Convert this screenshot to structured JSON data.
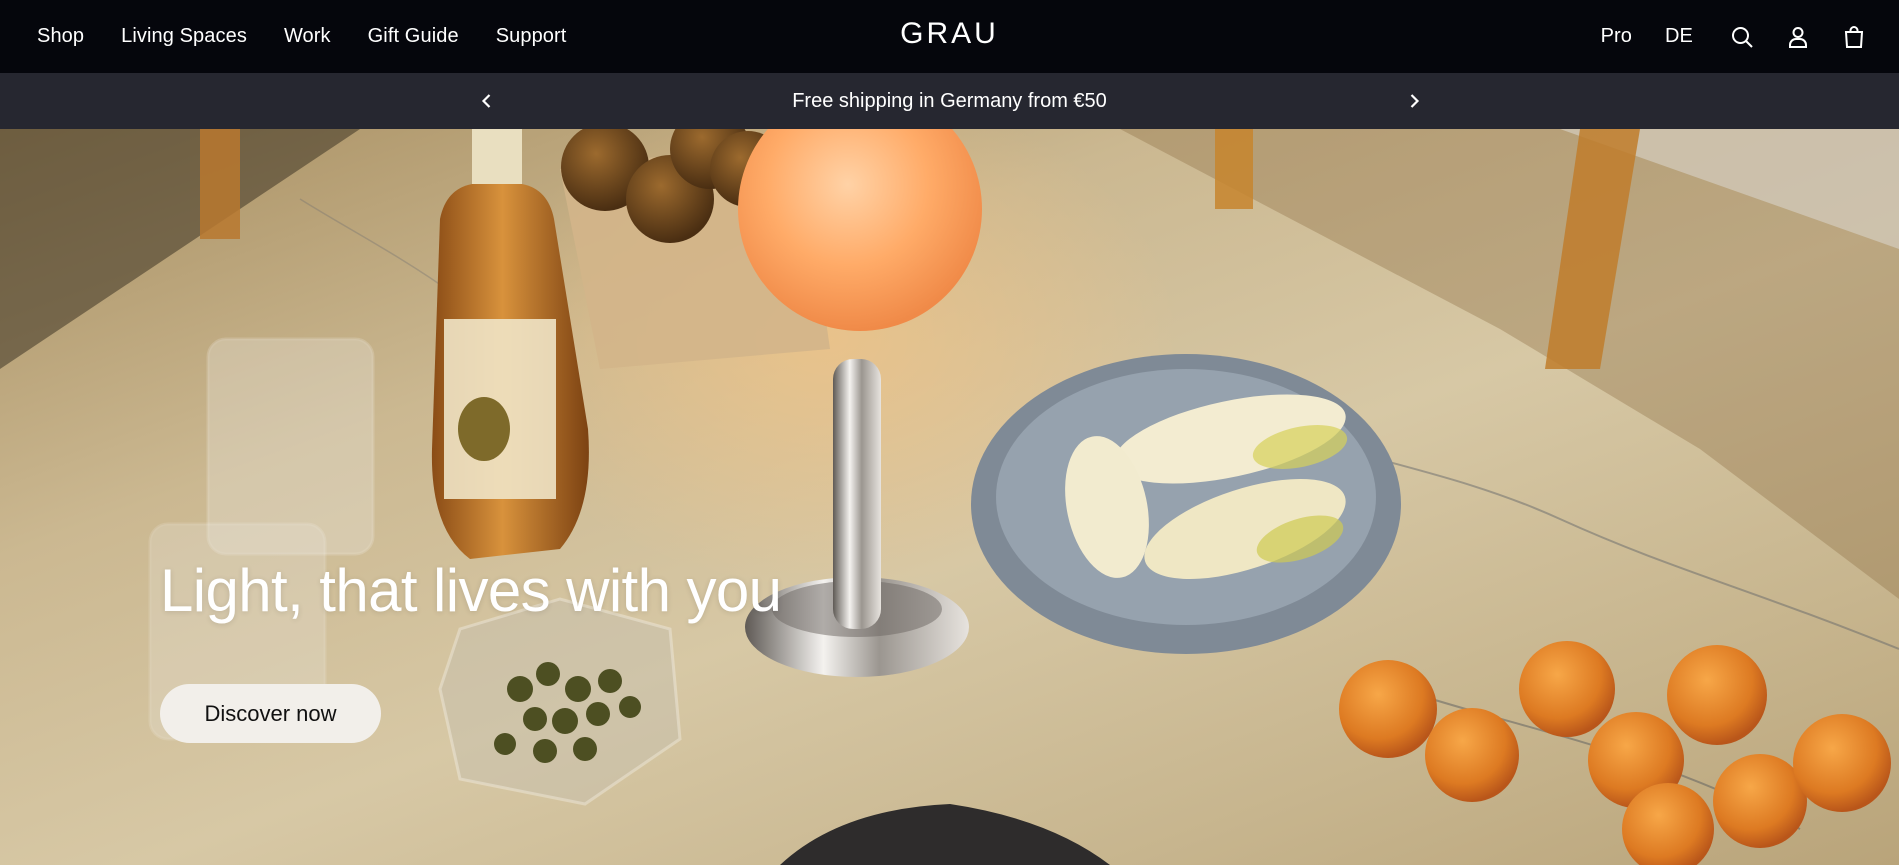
{
  "brand": {
    "logo": "GRAU"
  },
  "nav": {
    "left_items": [
      {
        "label": "Shop"
      },
      {
        "label": "Living Spaces"
      },
      {
        "label": "Work"
      },
      {
        "label": "Gift Guide"
      },
      {
        "label": "Support"
      }
    ],
    "right": {
      "pro_label": "Pro",
      "language_label": "DE",
      "icons": [
        "search-icon",
        "account-icon",
        "cart-icon"
      ]
    }
  },
  "announcement": {
    "text": "Free shipping in Germany from €50",
    "icons": [
      "chevron-left-icon",
      "chevron-right-icon"
    ]
  },
  "hero": {
    "title": "Light, that lives with you",
    "cta_label": "Discover now"
  },
  "colors": {
    "nav_background": "#05060c",
    "announcement_background": "#262730",
    "cta_background": "#f2efea",
    "text_light": "#ffffff"
  }
}
